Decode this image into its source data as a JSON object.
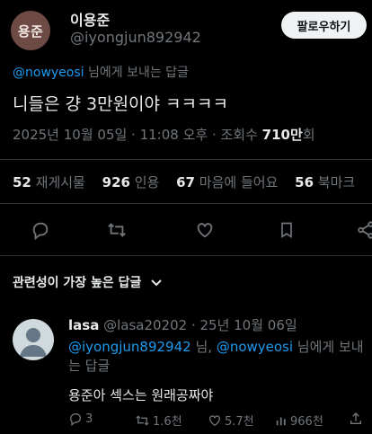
{
  "author": {
    "avatar_text": "용준",
    "display_name": "이용준",
    "handle": "@iyongjun892942",
    "follow_label": "팔로우하기"
  },
  "reply_to": {
    "mention": "@nowyeosi",
    "suffix": " 님에게 보내는 답글"
  },
  "tweet": {
    "text": "니들은 걍 3만원이야 ㅋㅋㅋㅋ",
    "date_time": "2025년 10월 05일 · 11:08 오후 · 조회수 ",
    "views": "710만",
    "views_suffix": "회"
  },
  "stats": [
    {
      "num": "52",
      "label": "재게시물"
    },
    {
      "num": "926",
      "label": "인용"
    },
    {
      "num": "67",
      "label": "마음에 들어요"
    },
    {
      "num": "56",
      "label": "북마크"
    }
  ],
  "section": {
    "title": "관련성이 가장 높은 답글",
    "chevron": "⌄"
  },
  "reply": {
    "name": "lasa",
    "handle_date": " @lasa20202 · 25년 10월 06일",
    "mention1": "@iyongjun892942",
    "mid": " 님, ",
    "mention2": "@nowyeosi",
    "suffix": " 님에게 보내는 답글",
    "text": "용준아 섹스는 원래공짜야",
    "replies": "3",
    "reposts": "1.6천",
    "likes": "5.7천",
    "views": "966천"
  },
  "colors": {
    "background": "#000000",
    "text": "#e7e9ea",
    "muted": "#71767b",
    "link": "#1d9bf0"
  }
}
